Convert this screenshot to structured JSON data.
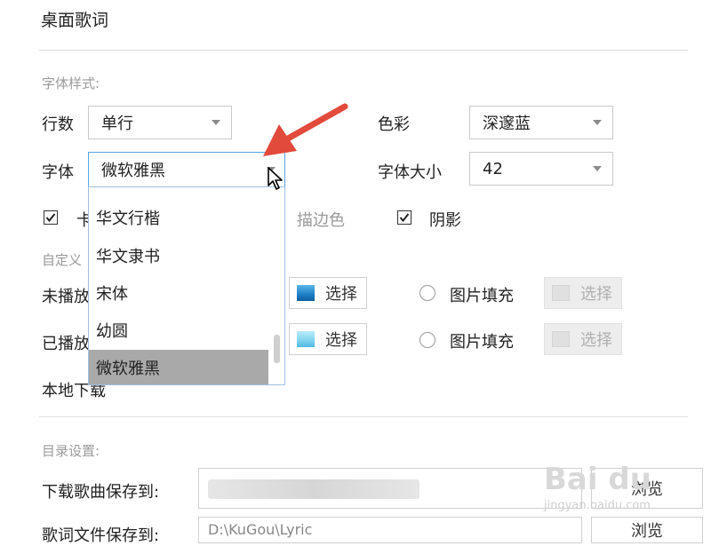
{
  "title": "桌面歌词",
  "font_style_section": "字体样式:",
  "rows": {
    "label": "行数",
    "value": "单行"
  },
  "color": {
    "label": "色彩",
    "value": "深邃蓝"
  },
  "font": {
    "label": "字体",
    "value": "微软雅黑",
    "options": [
      "华文行楷",
      "华文隶书",
      "宋体",
      "幼圆",
      "微软雅黑"
    ],
    "selected": "微软雅黑"
  },
  "font_size": {
    "label": "字体大小",
    "value": "42"
  },
  "checkbox_row": {
    "partial_label": "卡",
    "stroke_color_label": "描边色",
    "shadow_label": "阴影"
  },
  "custom_section_partial": "自定义",
  "unplayed": {
    "label_partial": "未播放",
    "select_btn": "选择",
    "image_fill_label": "图片填充",
    "image_select_btn": "选择",
    "swatch_color": "#1e7fc6"
  },
  "played": {
    "label_partial": "已播放",
    "select_btn": "选择",
    "image_fill_label": "图片填充",
    "image_select_btn": "选择",
    "swatch_color": "#7fd3ee"
  },
  "local_download_label": "本地下载",
  "directory_section": "目录设置:",
  "download_save": {
    "label": "下载歌曲保存到:",
    "browse_btn": "浏览"
  },
  "lyrics_save": {
    "label_partial": "歌词文件保存到:",
    "path_partial": "D:\\KuGou\\Lyric",
    "browse_btn": "浏览"
  },
  "watermark": {
    "logo": "Bai du",
    "sub": "jingyan.baidu.com"
  },
  "accent_colors": {
    "arrow": "#e24a3c",
    "focus_border": "#5aa3e0",
    "selected_item": "#a9a9a9"
  }
}
